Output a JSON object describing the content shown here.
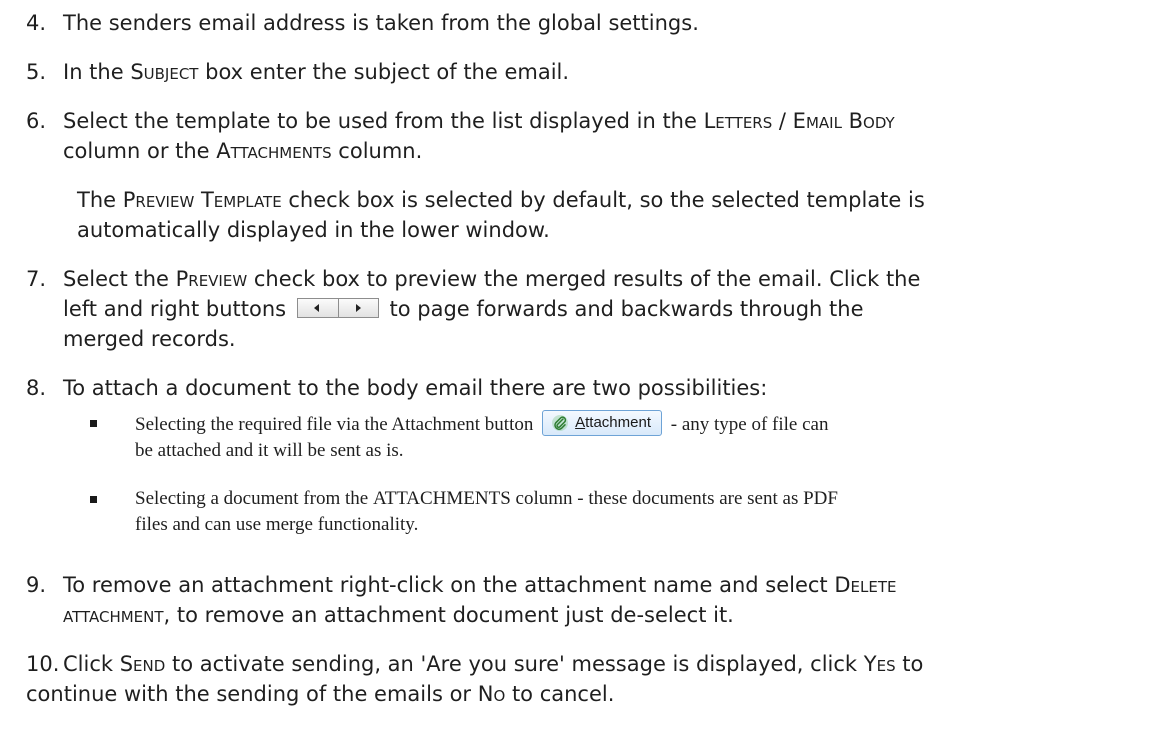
{
  "steps": [
    {
      "num": "4.",
      "text": "The senders email address is taken from the global settings."
    },
    {
      "num": "5.",
      "pre": "In the ",
      "sc1": "Subject",
      "post": " box enter the subject of the email."
    },
    {
      "num": "6.",
      "pre": "Select the template to be used from the list displayed in the ",
      "sc1": "Letters / Email Body",
      "mid": "column or the ",
      "sc2": "Attachments",
      "post": " column."
    },
    {
      "num": "7.",
      "pre": "Select the ",
      "sc1": "Preview",
      "post": " check box to preview the merged results of the email. Click the",
      "line2_pre": "left and right buttons",
      "line2_post": "to page forwards and backwards through the",
      "line3": "merged records."
    },
    {
      "num": "8.",
      "text": "To attach a document to the body email there are two possibilities:"
    },
    {
      "num": "9.",
      "pre": "To remove an attachment right-click on the attachment name and select ",
      "sc1": "Delete",
      "sc2": "attachment",
      "post": ", to remove an attachment document just de-select it."
    },
    {
      "num": "10.",
      "pre": "Click ",
      "sc1": "Send",
      "mid": " to activate sending, an 'Are you sure' message is displayed, click ",
      "sc2": "Yes",
      "mid2": " to",
      "line2_pre": "continue with the sending of the emails or ",
      "sc3": "No",
      "line2_post": " to cancel."
    }
  ],
  "note6": {
    "pre": "The ",
    "sc1": "Preview Template",
    "post": " check box is selected by default, so the selected template is",
    "line2": "automatically displayed in the lower window."
  },
  "bullets": [
    {
      "pre": "Selecting the required file via the Attachment button",
      "post": "- any type of file can",
      "line2": "be attached and it will be sent as is."
    },
    {
      "pre": "Selecting a document from the ",
      "sc1": "ATTACHMENTS",
      "post": " column - these documents are sent as PDF",
      "line2": "files and can use merge functionality."
    }
  ],
  "attachment_button": {
    "label_u": "A",
    "label_rest": "ttachment",
    "icon": "paperclip-icon"
  }
}
